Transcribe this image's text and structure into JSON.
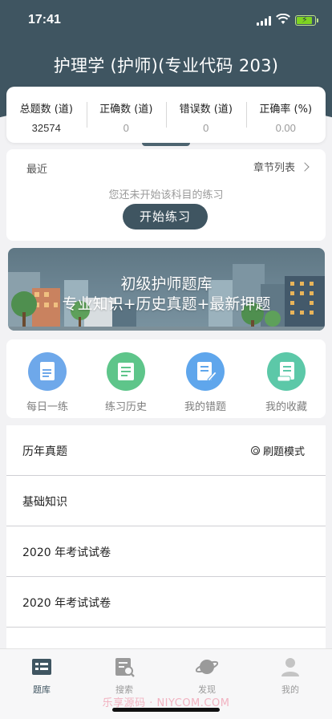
{
  "status": {
    "time": "17:41"
  },
  "header": {
    "title": "护理学 (护师)(专业代码 203)"
  },
  "stats": [
    {
      "label": "总题数 (道)",
      "value": "32574"
    },
    {
      "label": "正确数 (道)",
      "value": "0"
    },
    {
      "label": "错误数 (道)",
      "value": "0"
    },
    {
      "label": "正确率 (%)",
      "value": "0.00"
    }
  ],
  "recent": {
    "label": "最近",
    "chapter_link": "章节列表",
    "empty_text": "您还未开始该科目的练习",
    "start_button": "开始练习"
  },
  "banner": {
    "line1": "初级护师题库",
    "line2": "专业知识+历史真题+最新押题"
  },
  "shortcuts": [
    {
      "label": "每日一练",
      "icon": "daily-practice-icon",
      "color": "#6ea8ea"
    },
    {
      "label": "练习历史",
      "icon": "practice-history-icon",
      "color": "#5ec58a"
    },
    {
      "label": "我的错题",
      "icon": "wrong-questions-icon",
      "color": "#5fa6ec"
    },
    {
      "label": "我的收藏",
      "icon": "favorites-icon",
      "color": "#5cc8a8"
    }
  ],
  "list": {
    "items": [
      {
        "label": "历年真题"
      },
      {
        "label": "基础知识"
      },
      {
        "label": "2020 年考试试卷"
      },
      {
        "label": "2020 年考试试卷"
      }
    ],
    "mode_label": "刷题模式"
  },
  "tabbar": [
    {
      "label": "题库",
      "icon": "question-bank-icon"
    },
    {
      "label": "搜索",
      "icon": "search-icon"
    },
    {
      "label": "发现",
      "icon": "discover-planet-icon"
    },
    {
      "label": "我的",
      "icon": "profile-icon"
    }
  ],
  "watermark": "乐享源码 · NIYCOM.COM",
  "colors": {
    "header": "#3f5561",
    "accent": "#3f5561",
    "background": "#f2f2f4"
  }
}
